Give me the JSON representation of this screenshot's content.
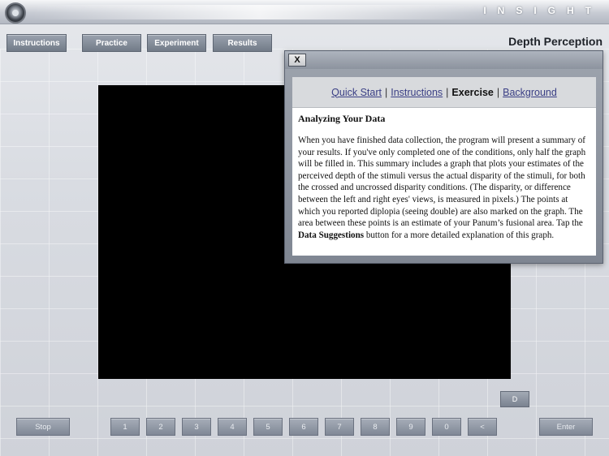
{
  "brand": "INSIGHT",
  "nav": {
    "instructions": "Instructions",
    "practice": "Practice",
    "experiment": "Experiment",
    "results": "Results"
  },
  "page_title": "Depth Perception",
  "panel": {
    "close_label": "X",
    "tabs": {
      "quick_start": "Quick Start",
      "instructions": "Instructions",
      "exercise": "Exercise",
      "background": "Background",
      "separator": "|"
    },
    "heading": "Analyzing Your Data",
    "body_before": "When you have finished data collection, the program will present a summary of your results. If you've only completed one of the conditions, only half the graph will be filled in. This summary includes a graph that plots your estimates of the perceived depth of the stimuli versus the actual disparity of the stimuli, for both the crossed and uncrossed disparity conditions. (The disparity, or difference between the left and right eyes' views, is measured in pixels.) The points at which you reported diplopia (seeing double) are also marked on the graph. The area between these points is an estimate of your Panum’s fusional area. Tap the ",
    "body_bold": "Data Suggestions",
    "body_after": " button for a more detailed explanation of this graph."
  },
  "controls": {
    "d_button": "D",
    "stop": "Stop",
    "keys": [
      "1",
      "2",
      "3",
      "4",
      "5",
      "6",
      "7",
      "8",
      "9",
      "0",
      "<"
    ],
    "enter": "Enter"
  },
  "colors": {
    "stage": "#000000",
    "button": "#7c8491",
    "link": "#3a3f85"
  }
}
